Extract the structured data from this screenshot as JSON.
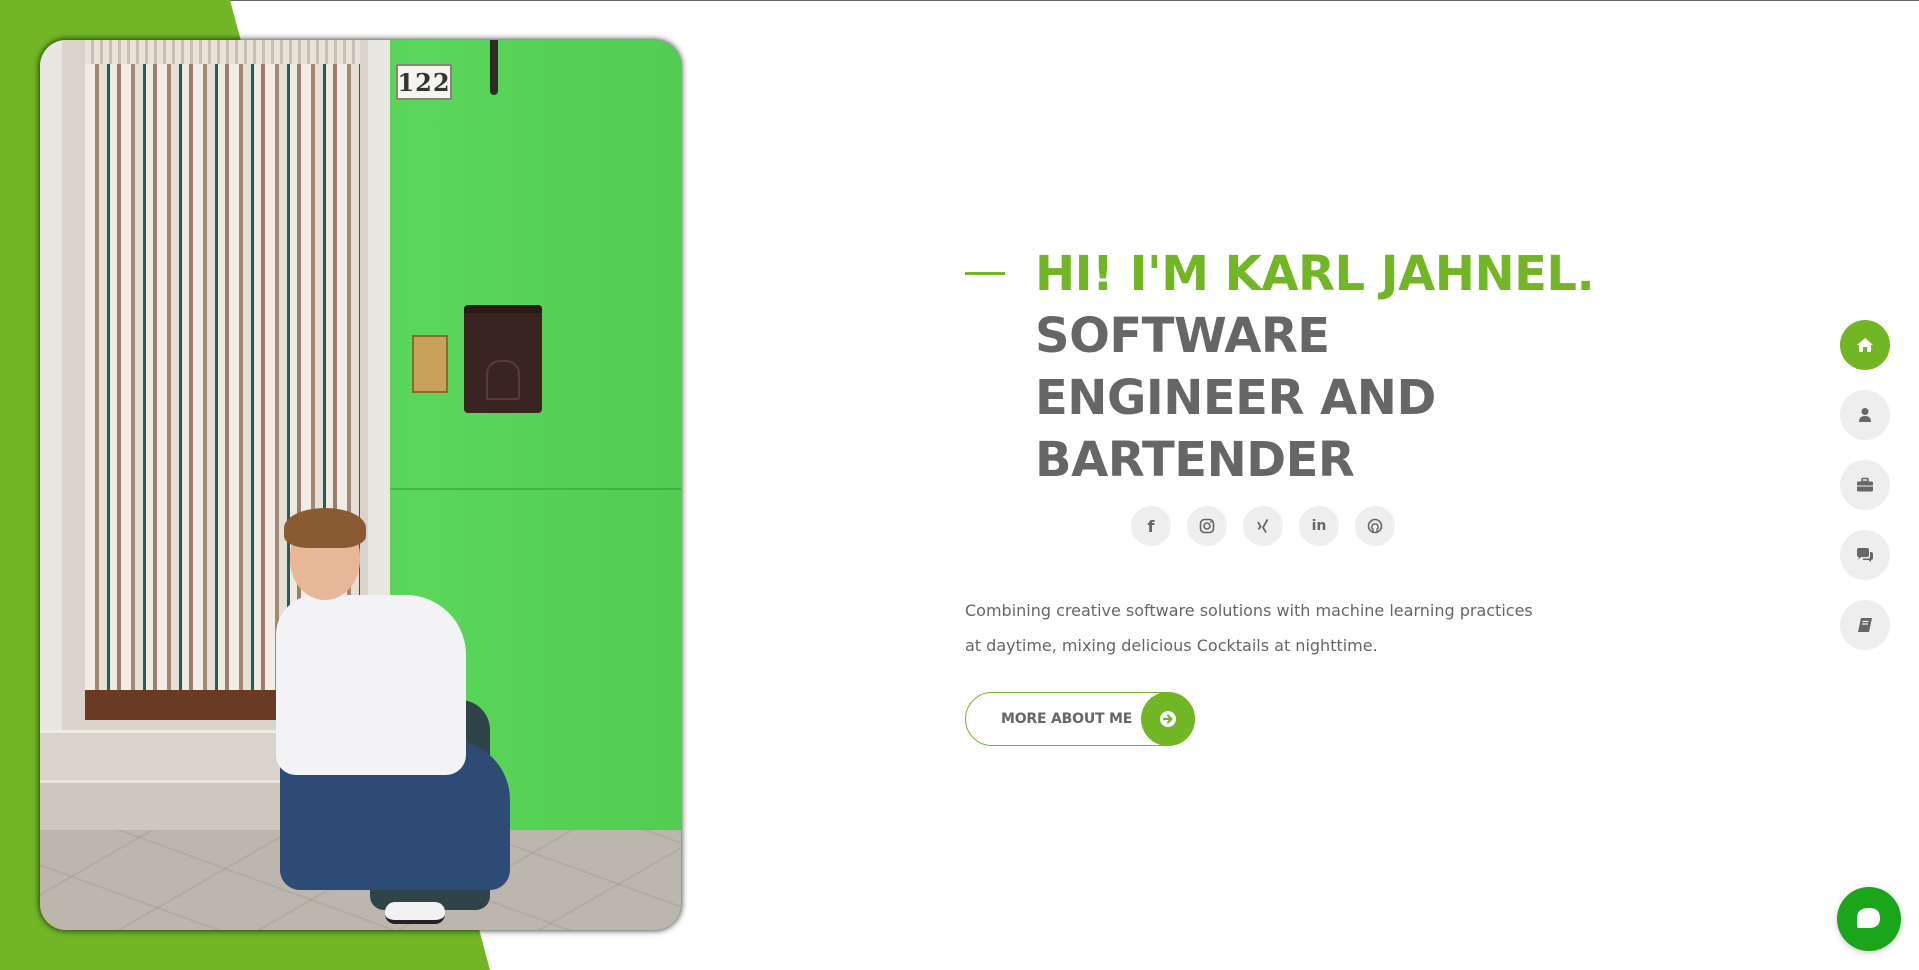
{
  "hero": {
    "greeting": "HI! I'M KARL JAHNEL.",
    "role_line1": "SOFTWARE",
    "role_line2": "ENGINEER AND",
    "role_line3": "BARTENDER",
    "description": "Combining creative software solutions with machine learning practices at daytime, mixing delicious Cocktails at nighttime.",
    "button_label": "MORE ABOUT ME"
  },
  "photo": {
    "house_number": "122"
  },
  "socials": [
    {
      "name": "facebook-icon",
      "glyph": "f"
    },
    {
      "name": "instagram-icon",
      "glyph": ""
    },
    {
      "name": "xing-icon",
      "glyph": "X"
    },
    {
      "name": "linkedin-icon",
      "glyph": "in"
    },
    {
      "name": "github-icon",
      "glyph": ""
    }
  ],
  "side_nav": [
    {
      "name": "home-icon",
      "active": true
    },
    {
      "name": "user-icon",
      "active": false
    },
    {
      "name": "briefcase-icon",
      "active": false
    },
    {
      "name": "comments-icon",
      "active": false
    },
    {
      "name": "book-icon",
      "active": false
    }
  ],
  "colors": {
    "accent": "#72b626",
    "text_gray": "#666666",
    "nav_bg": "#eeeeee",
    "chat_green": "#1aa51a"
  }
}
